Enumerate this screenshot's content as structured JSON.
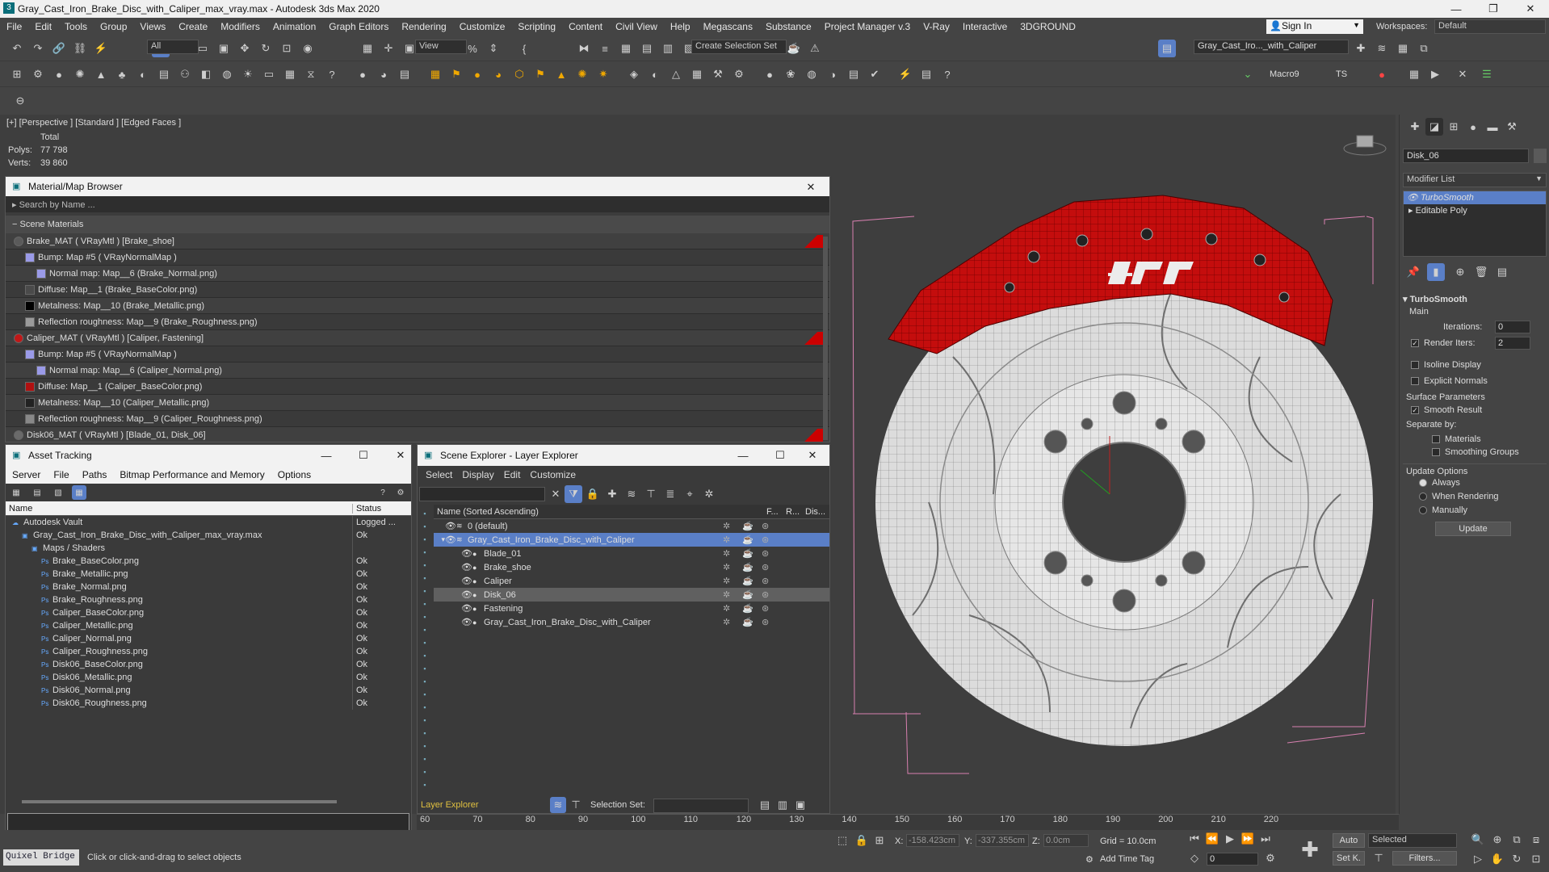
{
  "window": {
    "title": "Gray_Cast_Iron_Brake_Disc_with_Caliper_max_vray.max - Autodesk 3ds Max 2020",
    "minimize": "—",
    "maximize": "❐",
    "close": "✕"
  },
  "menu": [
    "File",
    "Edit",
    "Tools",
    "Group",
    "Views",
    "Create",
    "Modifiers",
    "Animation",
    "Graph Editors",
    "Rendering",
    "Customize",
    "Scripting",
    "Content",
    "Civil View",
    "Help",
    "Megascans",
    "Substance",
    "Project Manager v.3",
    "V-Ray",
    "Interactive",
    "3DGROUND"
  ],
  "signin": "Sign In",
  "workspaces_label": "Workspaces:",
  "workspace": "Default",
  "toolbar": {
    "filter": "All",
    "view": "View",
    "selection_set": "Create Selection Set",
    "scene_dropdown": "Gray_Cast_Iro..._with_Caliper",
    "macro": "Macro9",
    "ts": "TS"
  },
  "viewport": {
    "label": "[+] [Perspective ] [Standard ] [Edged Faces ]",
    "total": "Total",
    "polys_label": "Polys:",
    "polys": "77 798",
    "verts_label": "Verts:",
    "verts": "39 860"
  },
  "material_browser": {
    "title": "Material/Map Browser",
    "search": "Search by Name ...",
    "section": "Scene Materials",
    "rows": [
      {
        "text": "Brake_MAT  ( VRayMtl )  [Brake_shoe]",
        "level": 0,
        "sw": "#5a5a5a",
        "red": true
      },
      {
        "text": "Bump: Map #5  ( VRayNormalMap )",
        "level": 1,
        "sw": "#9a9ae8"
      },
      {
        "text": "Normal map: Map__6 (Brake_Normal.png)",
        "level": 2,
        "sw": "#9a9ae8"
      },
      {
        "text": "Diffuse: Map__1 (Brake_BaseColor.png)",
        "level": 1,
        "sw": "#4a4a4a"
      },
      {
        "text": "Metalness: Map__10 (Brake_Metallic.png)",
        "level": 1,
        "sw": "#000000"
      },
      {
        "text": "Reflection roughness: Map__9 (Brake_Roughness.png)",
        "level": 1,
        "sw": "#9a9a9a"
      },
      {
        "text": "Caliper_MAT  ( VRayMtl )  [Caliper, Fastening]",
        "level": 0,
        "sw": "#c01818",
        "red": true
      },
      {
        "text": "Bump: Map #5  ( VRayNormalMap )",
        "level": 1,
        "sw": "#9a9ae8"
      },
      {
        "text": "Normal map: Map__6 (Caliper_Normal.png)",
        "level": 2,
        "sw": "#9a9ae8"
      },
      {
        "text": "Diffuse: Map__1 (Caliper_BaseColor.png)",
        "level": 1,
        "sw": "#b01010"
      },
      {
        "text": "Metalness: Map__10 (Caliper_Metallic.png)",
        "level": 1,
        "sw": "#222222"
      },
      {
        "text": "Reflection roughness: Map__9 (Caliper_Roughness.png)",
        "level": 1,
        "sw": "#888888"
      },
      {
        "text": "Disk06_MAT  ( VRayMtl )  [Blade_01, Disk_06]",
        "level": 0,
        "sw": "#6a6a6a",
        "red": true
      }
    ]
  },
  "asset_tracking": {
    "title": "Asset Tracking",
    "menu": [
      "Server",
      "File",
      "Paths",
      "Bitmap Performance and Memory",
      "Options"
    ],
    "col_name": "Name",
    "col_status": "Status",
    "rows": [
      {
        "name": "Autodesk Vault",
        "status": "Logged ...",
        "level": 0
      },
      {
        "name": "Gray_Cast_Iron_Brake_Disc_with_Caliper_max_vray.max",
        "status": "Ok",
        "level": 1
      },
      {
        "name": "Maps / Shaders",
        "status": "",
        "level": 2
      },
      {
        "name": "Brake_BaseColor.png",
        "status": "Ok",
        "level": 3
      },
      {
        "name": "Brake_Metallic.png",
        "status": "Ok",
        "level": 3
      },
      {
        "name": "Brake_Normal.png",
        "status": "Ok",
        "level": 3
      },
      {
        "name": "Brake_Roughness.png",
        "status": "Ok",
        "level": 3
      },
      {
        "name": "Caliper_BaseColor.png",
        "status": "Ok",
        "level": 3
      },
      {
        "name": "Caliper_Metallic.png",
        "status": "Ok",
        "level": 3
      },
      {
        "name": "Caliper_Normal.png",
        "status": "Ok",
        "level": 3
      },
      {
        "name": "Caliper_Roughness.png",
        "status": "Ok",
        "level": 3
      },
      {
        "name": "Disk06_BaseColor.png",
        "status": "Ok",
        "level": 3
      },
      {
        "name": "Disk06_Metallic.png",
        "status": "Ok",
        "level": 3
      },
      {
        "name": "Disk06_Normal.png",
        "status": "Ok",
        "level": 3
      },
      {
        "name": "Disk06_Roughness.png",
        "status": "Ok",
        "level": 3
      }
    ]
  },
  "scene_explorer": {
    "title": "Scene Explorer - Layer Explorer",
    "menu": [
      "Select",
      "Display",
      "Edit",
      "Customize"
    ],
    "col_name": "Name (Sorted Ascending)",
    "col_f": "F...",
    "col_r": "R...",
    "col_d": "Dis...",
    "rows": [
      {
        "name": "0 (default)",
        "level": 0,
        "sel": false,
        "hi": false
      },
      {
        "name": "Gray_Cast_Iron_Brake_Disc_with_Caliper",
        "level": 0,
        "sel": true,
        "hi": false
      },
      {
        "name": "Blade_01",
        "level": 1,
        "sel": false,
        "hi": false
      },
      {
        "name": "Brake_shoe",
        "level": 1,
        "sel": false,
        "hi": false
      },
      {
        "name": "Caliper",
        "level": 1,
        "sel": false,
        "hi": false
      },
      {
        "name": "Disk_06",
        "level": 1,
        "sel": false,
        "hi": true
      },
      {
        "name": "Fastening",
        "level": 1,
        "sel": false,
        "hi": false
      },
      {
        "name": "Gray_Cast_Iron_Brake_Disc_with_Caliper",
        "level": 1,
        "sel": false,
        "hi": false
      }
    ],
    "footer_label": "Layer Explorer",
    "selection_set_label": "Selection Set:"
  },
  "command_panel": {
    "object_name": "Disk_06",
    "modifier_list": "Modifier List",
    "stack": [
      "TurboSmooth",
      "Editable Poly"
    ],
    "rollout": "TurboSmooth",
    "main": "Main",
    "iterations_label": "Iterations:",
    "iterations": "0",
    "render_iters_label": "Render Iters:",
    "render_iters": "2",
    "isoline": "Isoline Display",
    "explicit": "Explicit Normals",
    "surface": "Surface Parameters",
    "smooth": "Smooth Result",
    "separate": "Separate by:",
    "materials": "Materials",
    "smoothing": "Smoothing Groups",
    "update_options": "Update Options",
    "always": "Always",
    "when_rendering": "When Rendering",
    "manually": "Manually",
    "update": "Update"
  },
  "timeline": {
    "ticks": [
      "60",
      "70",
      "80",
      "90",
      "100",
      "110",
      "120",
      "130",
      "140",
      "150",
      "160",
      "170",
      "180",
      "190",
      "200",
      "210",
      "220"
    ]
  },
  "status": {
    "quixel": "Quixel Bridge",
    "prompt": "Click or click-and-drag to select objects",
    "x_label": "X:",
    "x": "-158.423cm",
    "y_label": "Y:",
    "y": "-337.355cm",
    "z_label": "Z:",
    "z": "0.0cm",
    "grid": "Grid = 10.0cm",
    "add_time_tag": "Add Time Tag",
    "auto": "Auto",
    "setk": "Set K.",
    "selected": "Selected",
    "filters": "Filters...",
    "frame": "0"
  }
}
